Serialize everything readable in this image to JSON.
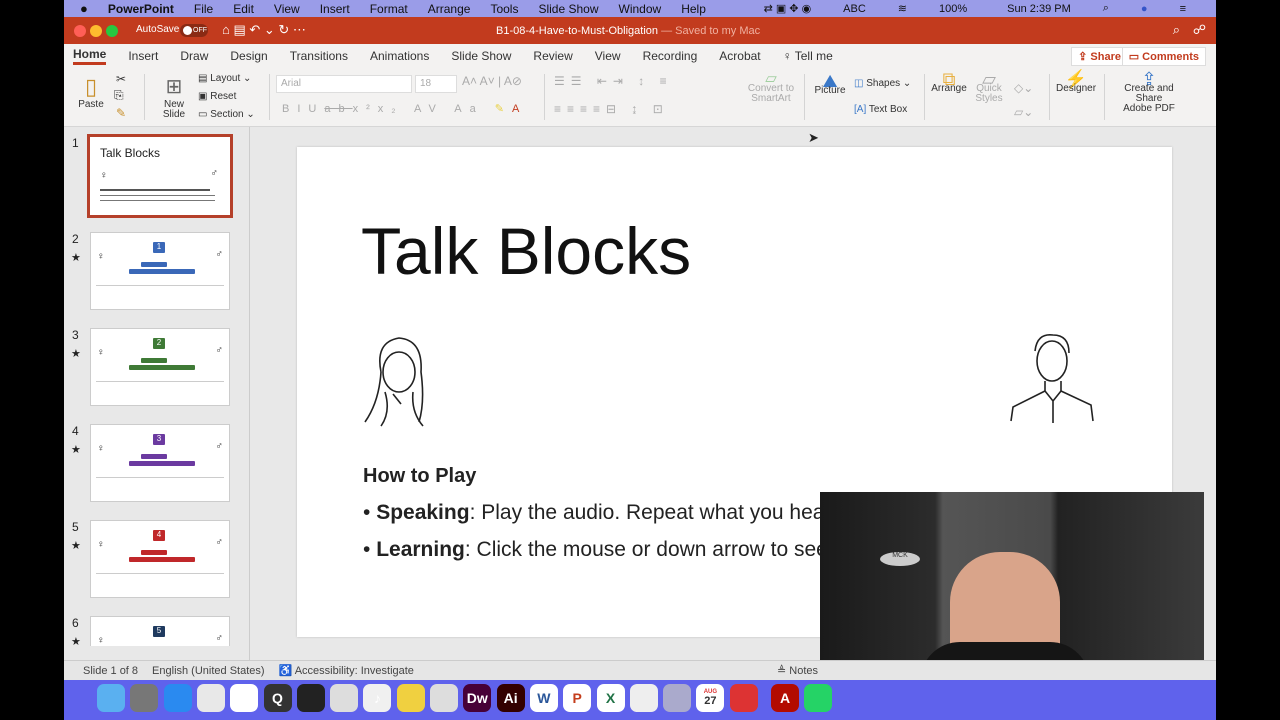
{
  "menubar": {
    "app": "PowerPoint",
    "items": [
      "File",
      "Edit",
      "View",
      "Insert",
      "Format",
      "Arrange",
      "Tools",
      "Slide Show",
      "Window",
      "Help"
    ],
    "input": "ABC",
    "battery": "100%",
    "clock": "Sun 2:39 PM"
  },
  "titlebar": {
    "autosave": "AutoSave",
    "toggle": "OFF",
    "title": "B1-08-4-Have-to-Must-Obligation",
    "saved": "— Saved to my Mac"
  },
  "tabs": [
    "Home",
    "Insert",
    "Draw",
    "Design",
    "Transitions",
    "Animations",
    "Slide Show",
    "Review",
    "View",
    "Recording",
    "Acrobat"
  ],
  "tell_me": "Tell me",
  "share": "Share",
  "comments": "Comments",
  "ribbon": {
    "paste": "Paste",
    "new_slide_1": "New",
    "new_slide_2": "Slide",
    "layout": "Layout",
    "reset": "Reset",
    "section": "Section",
    "font": "Arial",
    "size": "18",
    "smartart_1": "Convert to",
    "smartart_2": "SmartArt",
    "picture": "Picture",
    "shapes": "Shapes",
    "textbox": "Text Box",
    "arrange": "Arrange",
    "quick_1": "Quick",
    "quick_2": "Styles",
    "designer": "Designer",
    "pdf_1": "Create and Share",
    "pdf_2": "Adobe PDF"
  },
  "thumbs": [
    {
      "n": "1",
      "title": "Talk Blocks"
    },
    {
      "n": "2",
      "badge": "1",
      "color": "#3a68b8"
    },
    {
      "n": "3",
      "badge": "2",
      "color": "#3f7a36"
    },
    {
      "n": "4",
      "badge": "3",
      "color": "#6b3aa0"
    },
    {
      "n": "5",
      "badge": "4",
      "color": "#c0282a"
    },
    {
      "n": "6",
      "badge": "5",
      "color": "#1f3a5f"
    }
  ],
  "slide": {
    "title": "Talk Blocks",
    "howto": "How to Play",
    "b1_label": "Speaking",
    "b1_text": ": Play the audio.  Repeat what you hear.",
    "b2_label": "Learning",
    "b2_text": ": Click the mouse or down arrow to see the word order."
  },
  "status": {
    "slide": "Slide 1 of 8",
    "lang": "English (United States)",
    "access": "Accessibility: Investigate",
    "notes": "Notes"
  },
  "dock": {
    "cal_month": "AUG",
    "cal_day": "27"
  }
}
